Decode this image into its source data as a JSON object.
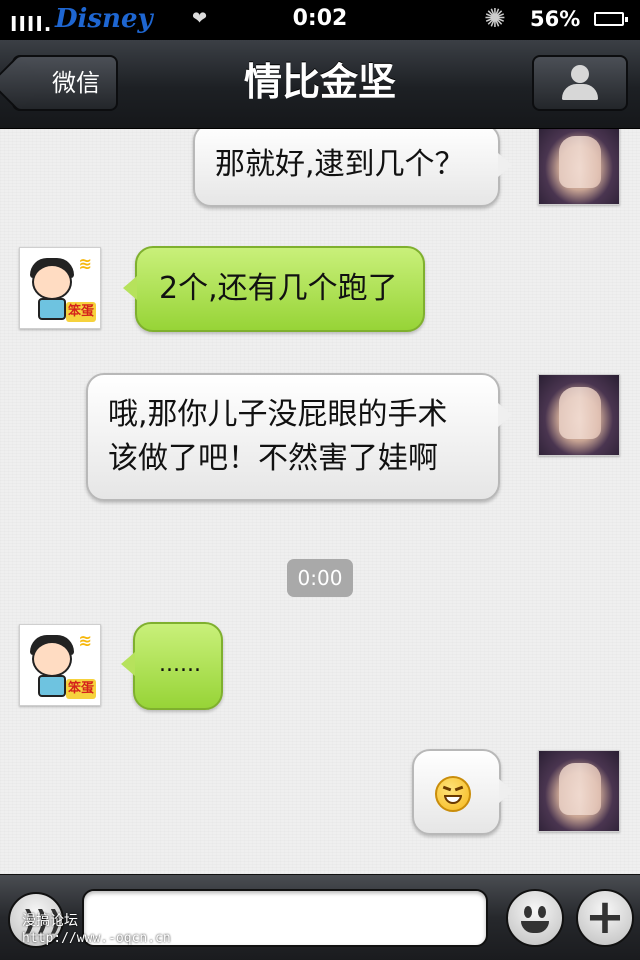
{
  "status_bar": {
    "signal": "IIII.",
    "carrier": "Disney",
    "time": "0:02",
    "battery_percent": "56%"
  },
  "nav": {
    "back_label": "微信",
    "title": "情比金坚"
  },
  "messages": [
    {
      "side": "out",
      "text": "那就好,逮到几个？"
    },
    {
      "side": "in",
      "text": "2个,还有几个跑了"
    },
    {
      "side": "out",
      "line1": "哦,那你儿子没屁眼的手术",
      "line2": "该做了吧！不然害了娃啊"
    },
    {
      "side": "in",
      "text": "......"
    },
    {
      "side": "out",
      "emoji": "grinning-squint-face"
    }
  ],
  "timestamp": "0:00",
  "avatar_badge": "笨蛋",
  "input": {
    "value": "",
    "placeholder": ""
  },
  "watermark": {
    "line1": "漫搞论坛",
    "line2": "http://www.-oqcn.cn"
  },
  "colors": {
    "incoming_bubble": "#a8dc4a",
    "outgoing_bubble": "#f4f4f4",
    "nav_bar": "#24272b"
  }
}
